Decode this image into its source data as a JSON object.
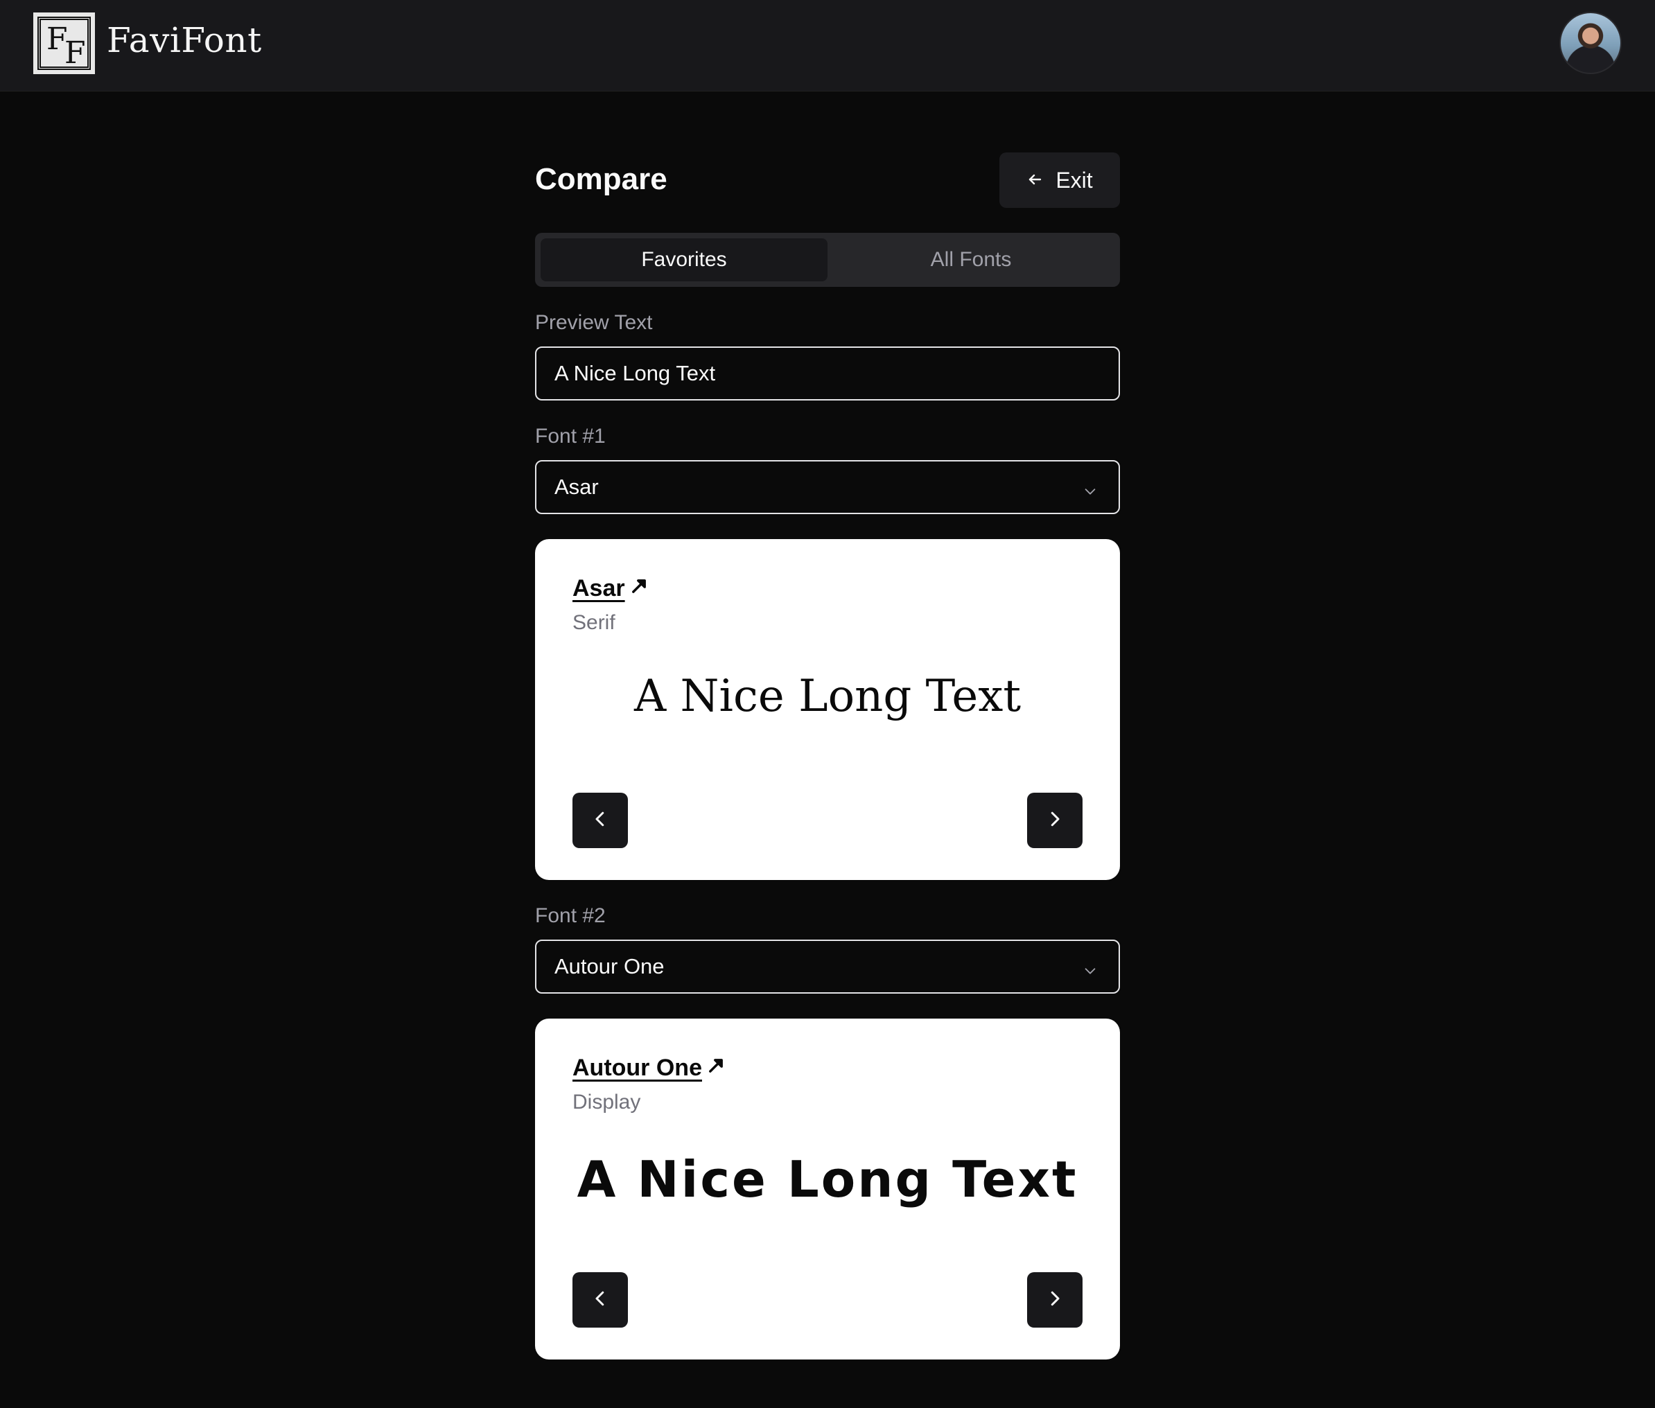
{
  "app": {
    "brand": "FaviFont",
    "logo_letters": [
      "F",
      "F"
    ]
  },
  "page": {
    "title": "Compare",
    "exit_label": "Exit"
  },
  "tabs": [
    {
      "label": "Favorites",
      "active": true
    },
    {
      "label": "All Fonts",
      "active": false
    }
  ],
  "preview": {
    "label": "Preview Text",
    "value": "A Nice Long Text"
  },
  "font1": {
    "label": "Font #1",
    "selected": "Asar",
    "card": {
      "name": "Asar",
      "category": "Serif",
      "sample": "A Nice Long Text"
    }
  },
  "font2": {
    "label": "Font #2",
    "selected": "Autour One",
    "card": {
      "name": "Autour One",
      "category": "Display",
      "sample": "A Nice Long Text"
    }
  },
  "icons": {
    "exit": "arrow-left-icon",
    "select": "chevron-down-icon",
    "external": "arrow-up-right-icon",
    "prev": "chevron-left-icon",
    "next": "chevron-right-icon"
  },
  "colors": {
    "background": "#0a0a0a",
    "header": "#18181b",
    "card": "#ffffff",
    "muted_text": "#a1a1aa",
    "button_dark": "#18181b"
  }
}
